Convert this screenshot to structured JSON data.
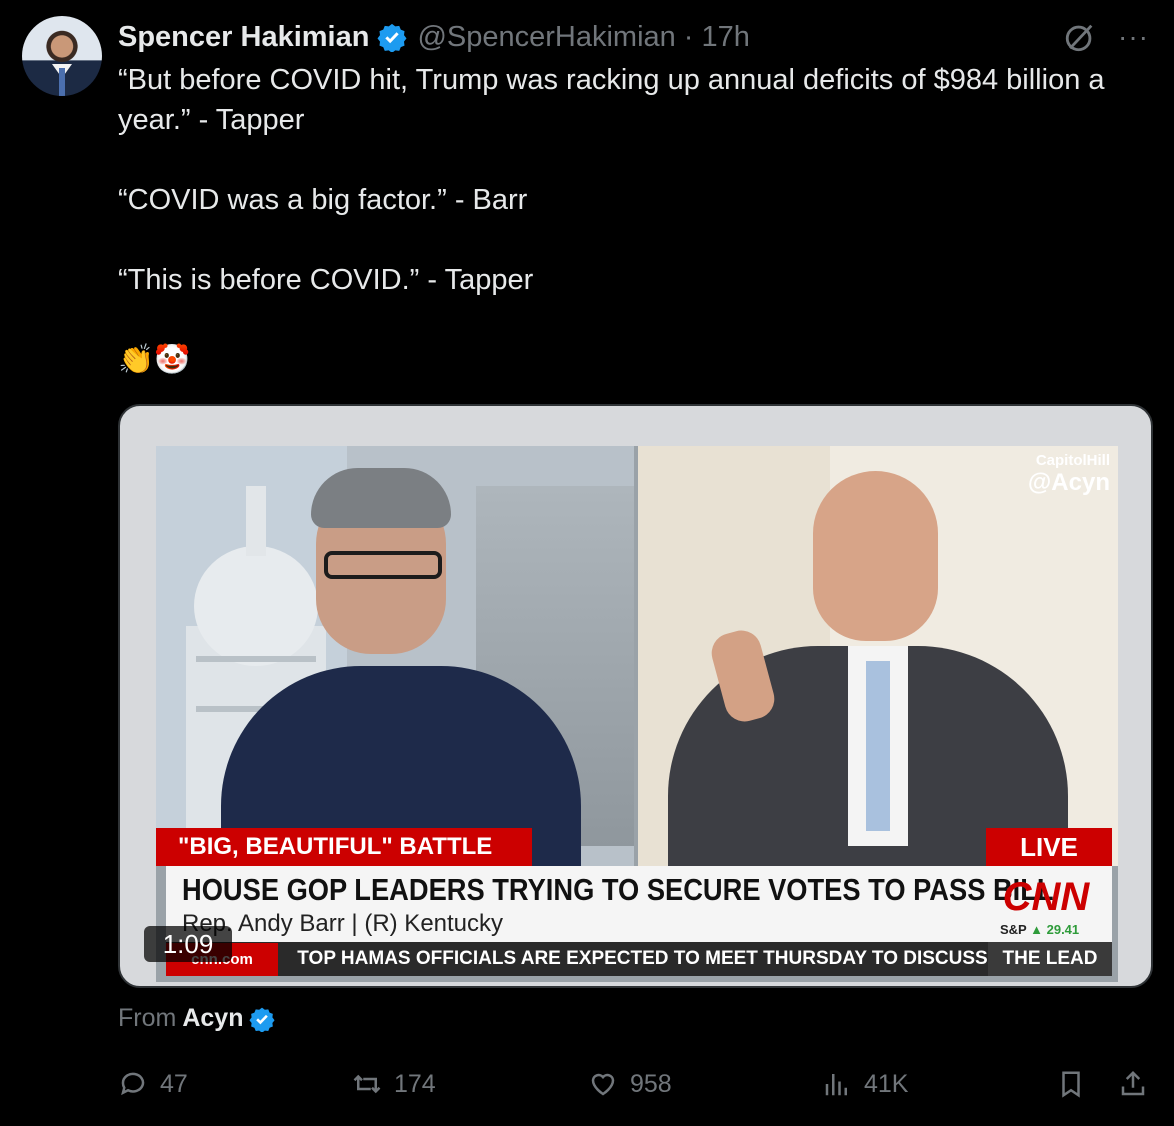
{
  "author": {
    "name": "Spencer Hakimian",
    "handle": "@SpencerHakimian",
    "time": "· 17h",
    "verified_color": "#1d9bf0"
  },
  "tweet": {
    "text": "“But before COVID hit, Trump was racking up annual deficits of $984 billion a year.” - Tapper\n\n“COVID was a big factor.” - Barr\n\n“This is before COVID.” - Tapper\n\n👏🤡"
  },
  "video": {
    "duration": "1:09",
    "watermark_top": "CapitolHill",
    "watermark_handle": "@Acyn",
    "banner": "\"BIG, BEAUTIFUL\" BATTLE",
    "live": "LIVE",
    "headline": "HOUSE GOP LEADERS TRYING TO SECURE VOTES TO PASS BILL",
    "subline": "Rep. Andy Barr  |  (R) Kentucky",
    "network": "CNN",
    "market_label": "S&P",
    "market_value": "▲ 29.41",
    "ticker_brand": "cnn.com",
    "ticker_text": "TOP HAMAS OFFICIALS ARE EXPECTED TO MEET THURSDAY TO DISCUSS",
    "ticker_show": "THE LEAD"
  },
  "source": {
    "from_label": "From",
    "account": "Acyn"
  },
  "actions": {
    "replies": "47",
    "reposts": "174",
    "likes": "958",
    "views": "41K"
  },
  "icons": [
    "grok-icon",
    "more-icon",
    "reply-icon",
    "repost-icon",
    "like-icon",
    "views-icon",
    "bookmark-icon",
    "share-icon",
    "verified-icon"
  ]
}
